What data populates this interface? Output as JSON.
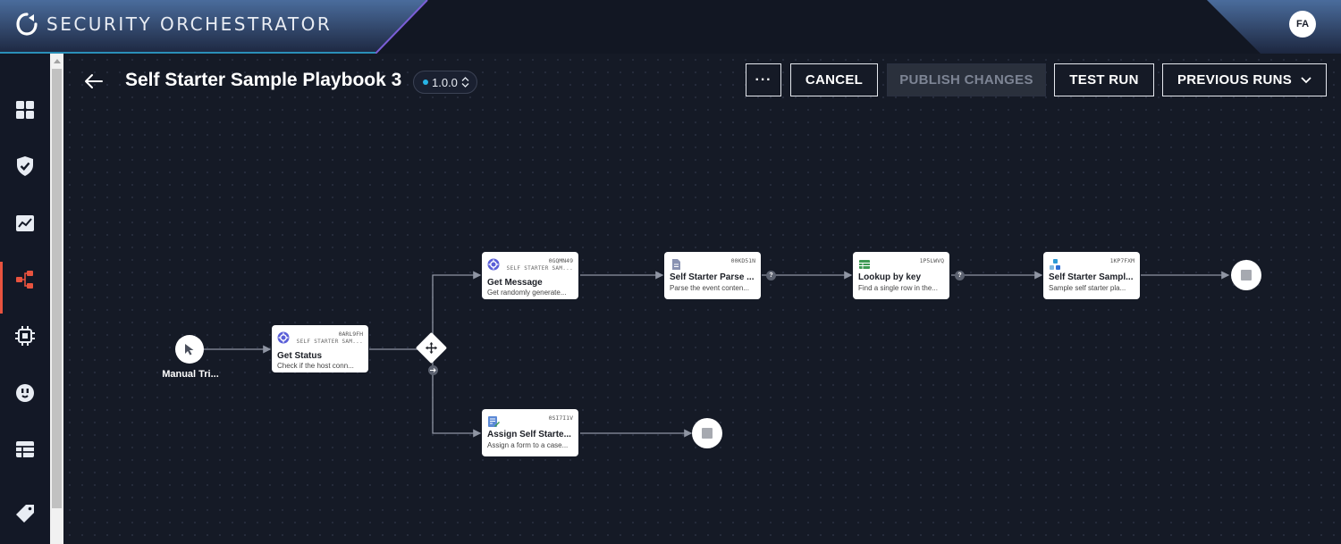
{
  "app": {
    "title": "SECURITY ORCHESTRATOR",
    "user_initials": "FA",
    "colors": {
      "accent": "#e8533f",
      "version_dot": "#27b4e6",
      "brand_band": "#3b5a8a"
    }
  },
  "sidebar": {
    "items": [
      {
        "name": "dashboard",
        "icon": "grid-icon"
      },
      {
        "name": "cases",
        "icon": "shield-check-icon"
      },
      {
        "name": "reports",
        "icon": "chart-icon"
      },
      {
        "name": "playbooks",
        "icon": "workflow-icon",
        "active": true
      },
      {
        "name": "functions",
        "icon": "chip-icon"
      },
      {
        "name": "plugins",
        "icon": "plug-icon"
      },
      {
        "name": "tables",
        "icon": "table-icon"
      },
      {
        "name": "tags",
        "icon": "tag-icon"
      }
    ]
  },
  "header": {
    "title": "Self Starter Sample Playbook 3",
    "version": "1.0.0",
    "more_label": "···",
    "cancel_label": "CANCEL",
    "publish_label": "PUBLISH CHANGES",
    "test_run_label": "TEST RUN",
    "previous_runs_label": "PREVIOUS RUNS"
  },
  "workflow": {
    "trigger": {
      "label": "Manual Tri..."
    },
    "nodes": {
      "get_status": {
        "id": "0ARL9FH",
        "type": "SELF STARTER SAM...",
        "name": "Get Status",
        "desc": "Check if the host conn...",
        "icon": "gear-badge-icon"
      },
      "get_message": {
        "id": "0GQMN49",
        "type": "SELF STARTER SAM...",
        "name": "Get Message",
        "desc": "Get randomly generate...",
        "icon": "gear-badge-icon"
      },
      "parse": {
        "id": "00KD51N",
        "name": "Self Starter Parse ...",
        "desc": "Parse the event conten...",
        "icon": "document-icon"
      },
      "lookup": {
        "id": "1P5LWVQ",
        "name": "Lookup by key",
        "desc": "Find a single row in the...",
        "icon": "table-icon"
      },
      "sample": {
        "id": "1KP7FXM",
        "name": "Self Starter Sampl...",
        "desc": "Sample self starter pla...",
        "icon": "nodes-icon"
      },
      "assign": {
        "id": "0SI7I1V",
        "name": "Assign Self Starte...",
        "desc": "Assign a form to a case...",
        "icon": "form-edit-icon"
      }
    },
    "badge_q": "?"
  }
}
